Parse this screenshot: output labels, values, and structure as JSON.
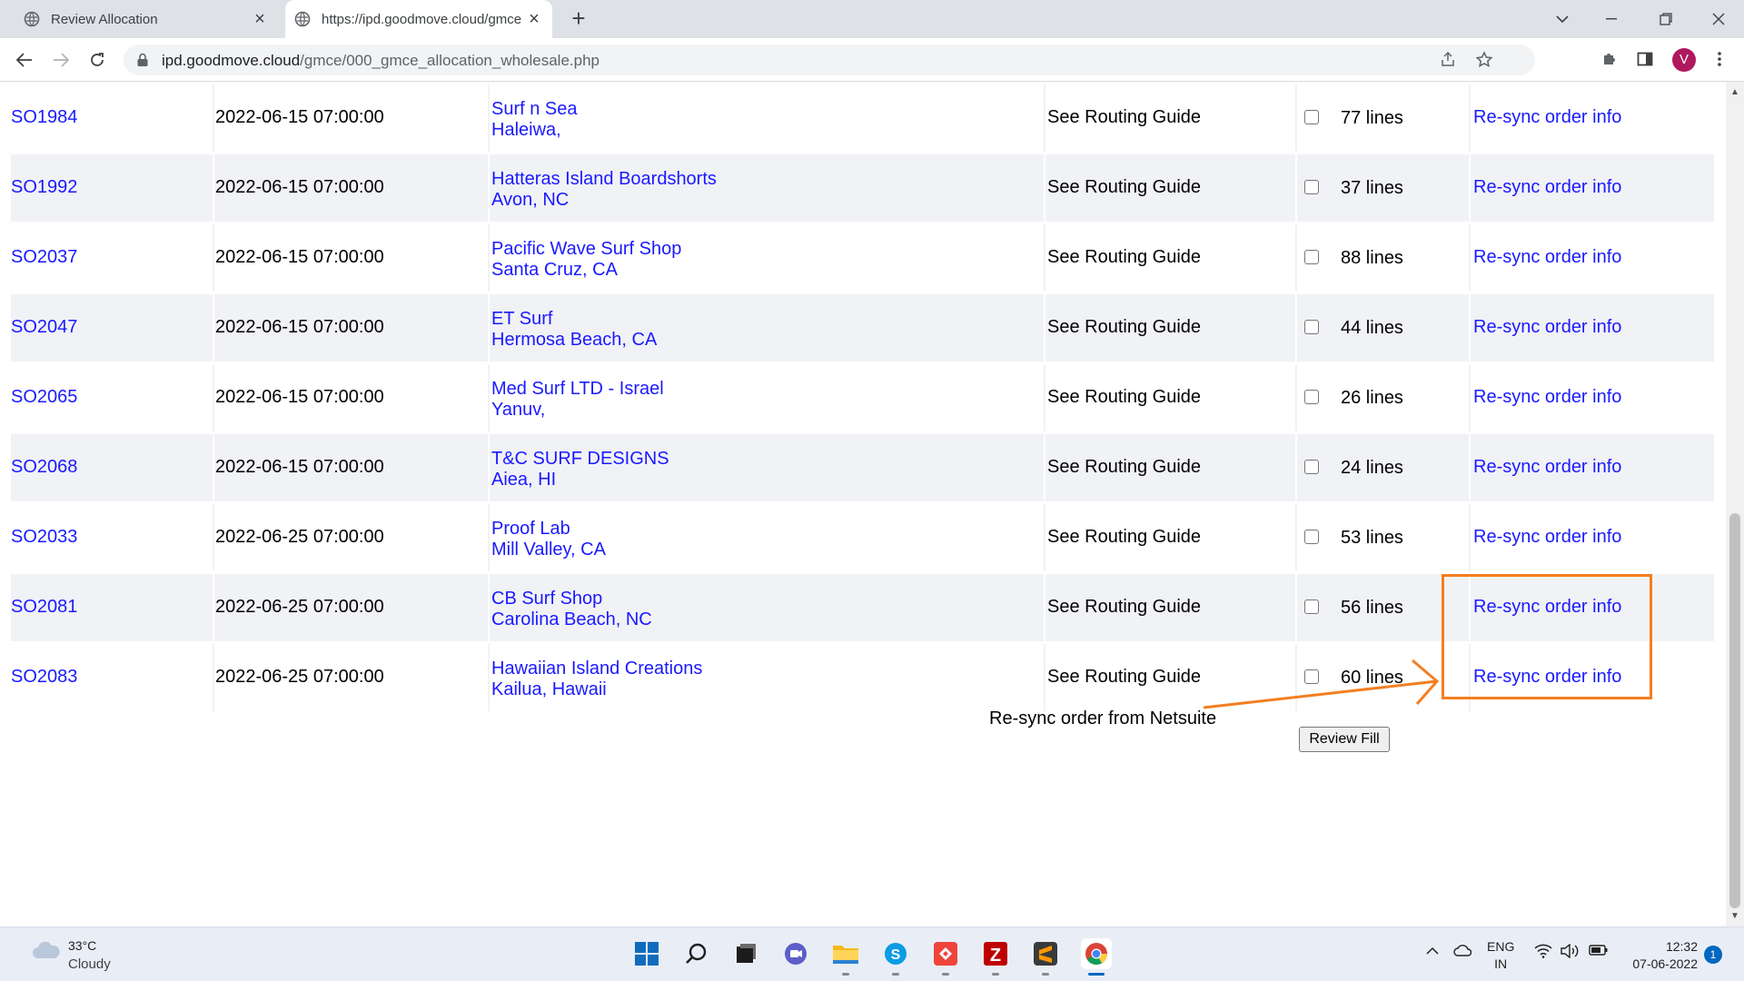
{
  "browser": {
    "tabs": [
      {
        "title": "Review Allocation",
        "active": false
      },
      {
        "title": "https://ipd.goodmove.cloud/gmce",
        "active": true
      }
    ],
    "url_host": "ipd.goodmove.cloud",
    "url_path": "/gmce/000_gmce_allocation_wholesale.php",
    "profile_initial": "V"
  },
  "orders": [
    {
      "so": "SO1984",
      "date": "2022-06-15 07:00:00",
      "customer": "Surf n Sea",
      "location": "Haleiwa,",
      "routing": "See Routing Guide",
      "lines": "77 lines",
      "resync": "Re-sync order info"
    },
    {
      "so": "SO1992",
      "date": "2022-06-15 07:00:00",
      "customer": "Hatteras Island Boardshorts",
      "location": "Avon, NC",
      "routing": "See Routing Guide",
      "lines": "37 lines",
      "resync": "Re-sync order info"
    },
    {
      "so": "SO2037",
      "date": "2022-06-15 07:00:00",
      "customer": "Pacific Wave Surf Shop",
      "location": "Santa Cruz, CA",
      "routing": "See Routing Guide",
      "lines": "88 lines",
      "resync": "Re-sync order info"
    },
    {
      "so": "SO2047",
      "date": "2022-06-15 07:00:00",
      "customer": "ET Surf",
      "location": "Hermosa Beach, CA",
      "routing": "See Routing Guide",
      "lines": "44 lines",
      "resync": "Re-sync order info"
    },
    {
      "so": "SO2065",
      "date": "2022-06-15 07:00:00",
      "customer": "Med Surf LTD - Israel",
      "location": "Yanuv,",
      "routing": "See Routing Guide",
      "lines": "26 lines",
      "resync": "Re-sync order info"
    },
    {
      "so": "SO2068",
      "date": "2022-06-15 07:00:00",
      "customer": "T&C SURF DESIGNS",
      "location": "Aiea, HI",
      "routing": "See Routing Guide",
      "lines": "24 lines",
      "resync": "Re-sync order info"
    },
    {
      "so": "SO2033",
      "date": "2022-06-25 07:00:00",
      "customer": "Proof Lab",
      "location": "Mill Valley, CA",
      "routing": "See Routing Guide",
      "lines": "53 lines",
      "resync": "Re-sync order info"
    },
    {
      "so": "SO2081",
      "date": "2022-06-25 07:00:00",
      "customer": "CB Surf Shop",
      "location": "Carolina Beach, NC",
      "routing": "See Routing Guide",
      "lines": "56 lines",
      "resync": "Re-sync order info"
    },
    {
      "so": "SO2083",
      "date": "2022-06-25 07:00:00",
      "customer": "Hawaiian Island Creations",
      "location": "Kailua, Hawaii",
      "routing": "See Routing Guide",
      "lines": "60 lines",
      "resync": "Re-sync order info"
    }
  ],
  "review_fill_label": "Review Fill",
  "annotation": {
    "text": "Re-sync order from Netsuite",
    "color": "#f47e20"
  },
  "taskbar": {
    "weather_temp": "33°C",
    "weather_desc": "Cloudy",
    "lang_1": "ENG",
    "lang_2": "IN",
    "time": "12:32",
    "date": "07-06-2022",
    "notification_count": "1"
  },
  "colors": {
    "link": "#1a1aff",
    "row_shade": "#f1f2f6",
    "annotation": "#f47e20"
  }
}
